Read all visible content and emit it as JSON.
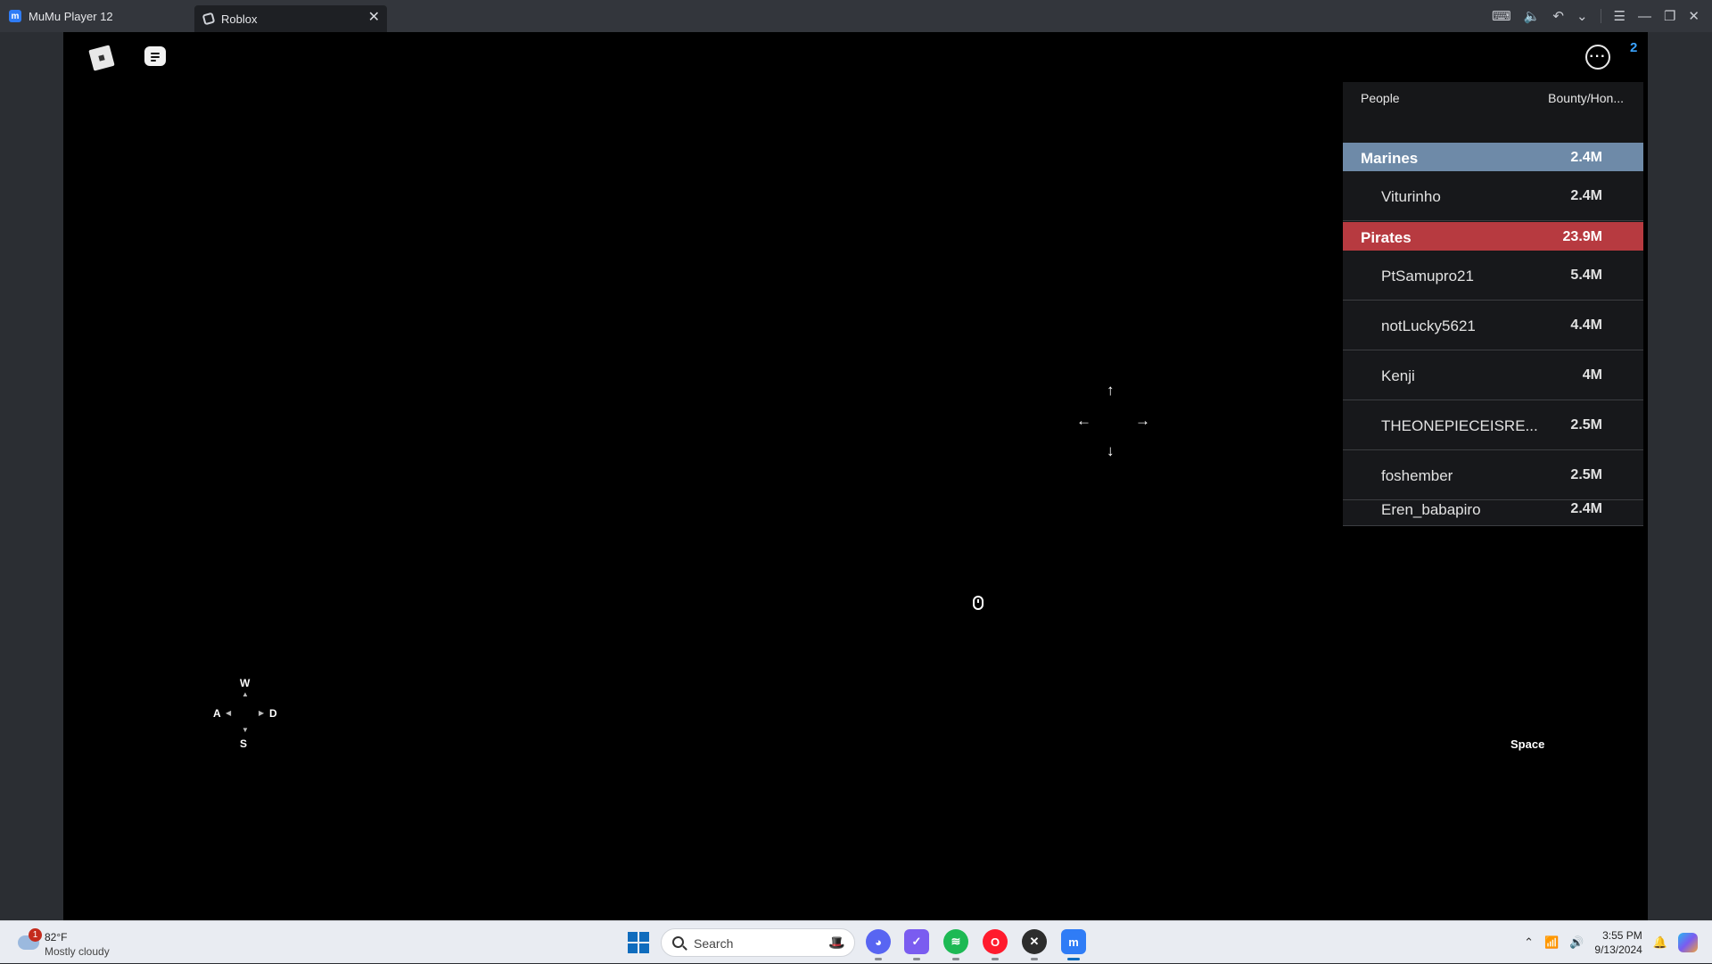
{
  "window": {
    "tabs": [
      {
        "label": "MuMu Player 12"
      },
      {
        "label": "Roblox"
      }
    ]
  },
  "game": {
    "notification_count": "2",
    "leaderboard": {
      "header_people": "People",
      "header_stat": "Bounty/Hon...",
      "teams": [
        {
          "name": "Marines",
          "value": "2.4M",
          "color": "#6e8aa8",
          "players": [
            {
              "name": "Viturinho",
              "value": "2.4M"
            }
          ]
        },
        {
          "name": "Pirates",
          "value": "23.9M",
          "color": "#b73a40",
          "players": [
            {
              "name": "PtSamupro21",
              "value": "5.4M"
            },
            {
              "name": "notLucky5621",
              "value": "4.4M"
            },
            {
              "name": "Kenji",
              "value": "4M"
            },
            {
              "name": "THEONEPIECEISRE...",
              "value": "2.5M"
            },
            {
              "name": "foshember",
              "value": "2.5M"
            },
            {
              "name": "Eren_babapiro",
              "value": "2.4M"
            }
          ]
        }
      ]
    },
    "controls": {
      "keys": {
        "w": "W",
        "a": "A",
        "s": "S",
        "d": "D"
      },
      "space_label": "Space",
      "arrows": {
        "up": "↑",
        "down": "↓",
        "left": "←",
        "right": "→"
      }
    }
  },
  "taskbar": {
    "weather_badge": "1",
    "weather_temp": "82°F",
    "weather_condition": "Mostly cloudy",
    "search_placeholder": "Search",
    "time": "3:55 PM",
    "date": "9/13/2024"
  }
}
